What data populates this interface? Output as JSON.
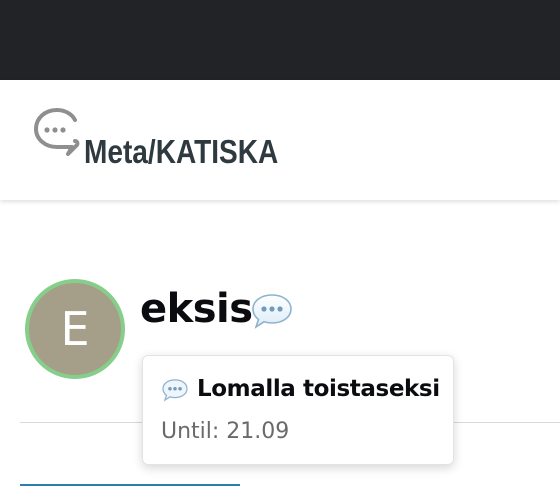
{
  "header": {
    "site_title": "Meta/KATISKA",
    "logo_icon": "discourse-chat-bubble-icon"
  },
  "user": {
    "avatar_letter": "E",
    "username": "eksis",
    "status_icon": "speech-balloon-icon"
  },
  "status_tooltip": {
    "emoji_icon": "speech-balloon-icon",
    "description": "Lomalla toistaseksi",
    "until": "Until: 21.09"
  },
  "colors": {
    "top_bar": "#222327",
    "title_text": "#2f3940",
    "avatar_bg": "#a59e88",
    "avatar_ring": "#87ce8b",
    "link_accent": "#2a7fb0"
  }
}
